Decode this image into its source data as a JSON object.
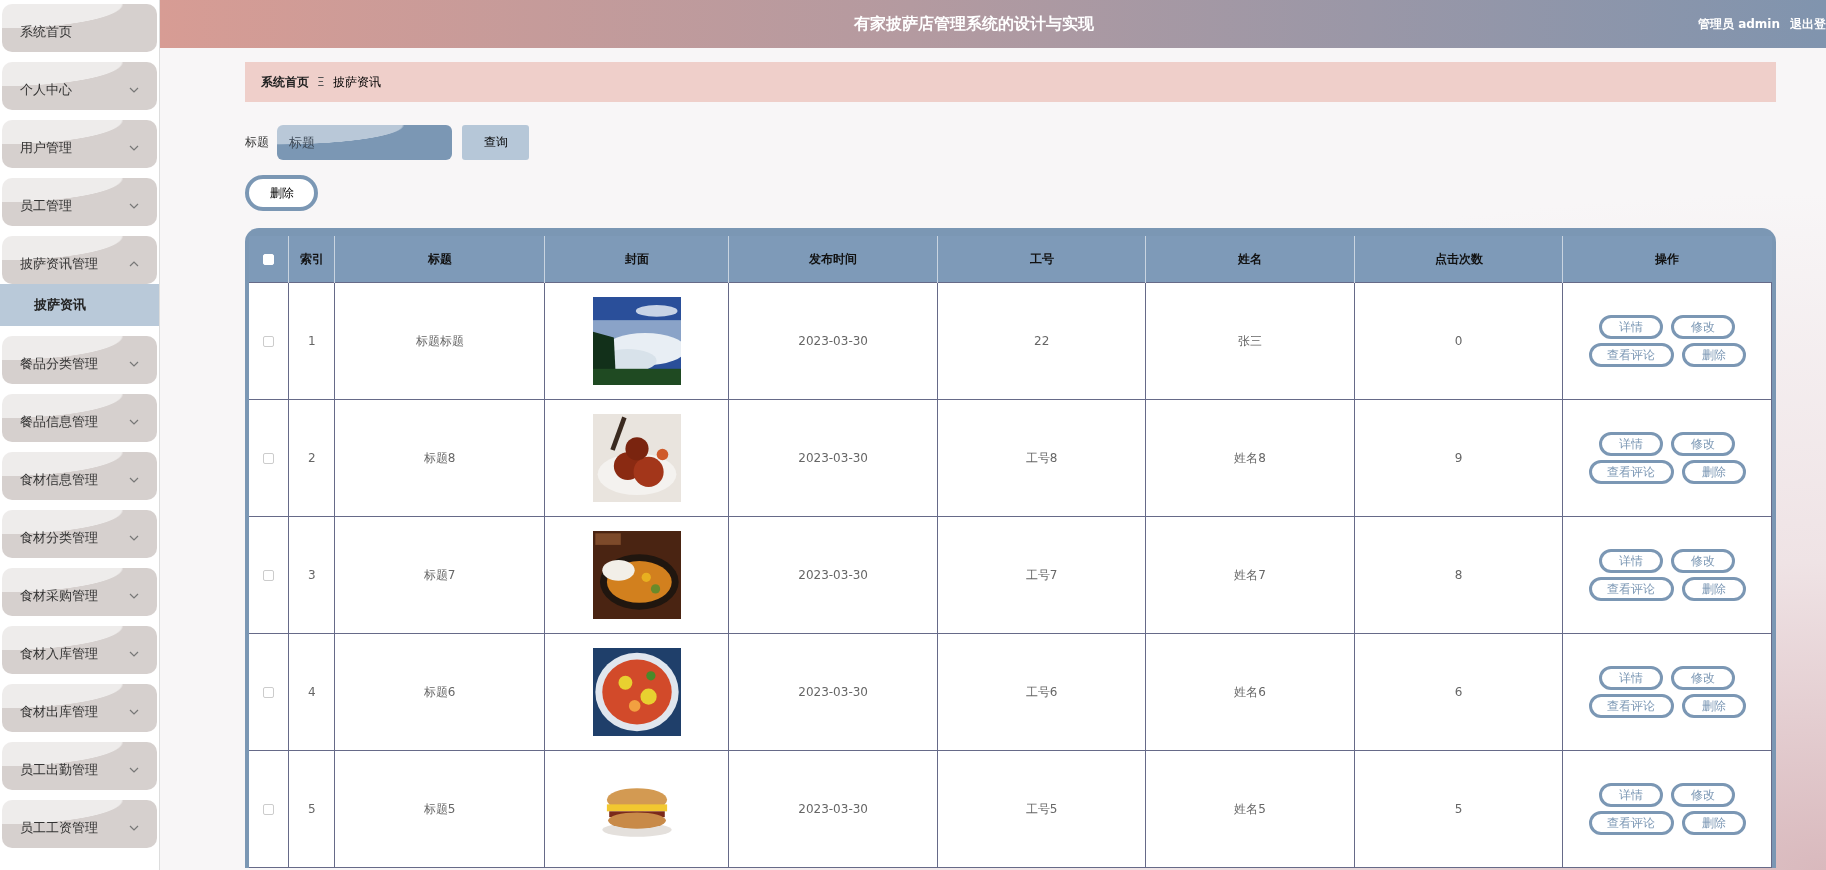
{
  "header": {
    "title": "有家披萨店管理系统的设计与实现",
    "user": "管理员 admin",
    "logout": "退出登"
  },
  "sidebar": {
    "items": [
      {
        "label": "系统首页",
        "kind": "link"
      },
      {
        "label": "个人中心",
        "kind": "menu",
        "expanded": false
      },
      {
        "label": "用户管理",
        "kind": "menu",
        "expanded": false
      },
      {
        "label": "员工管理",
        "kind": "menu",
        "expanded": false
      },
      {
        "label": "披萨资讯管理",
        "kind": "menu",
        "expanded": true,
        "children": [
          {
            "label": "披萨资讯",
            "selected": true
          }
        ]
      },
      {
        "label": "餐品分类管理",
        "kind": "menu",
        "expanded": false
      },
      {
        "label": "餐品信息管理",
        "kind": "menu",
        "expanded": false
      },
      {
        "label": "食材信息管理",
        "kind": "menu",
        "expanded": false
      },
      {
        "label": "食材分类管理",
        "kind": "menu",
        "expanded": false
      },
      {
        "label": "食材采购管理",
        "kind": "menu",
        "expanded": false
      },
      {
        "label": "食材入库管理",
        "kind": "menu",
        "expanded": false
      },
      {
        "label": "食材出库管理",
        "kind": "menu",
        "expanded": false
      },
      {
        "label": "员工出勤管理",
        "kind": "menu",
        "expanded": false
      },
      {
        "label": "员工工资管理",
        "kind": "menu",
        "expanded": false
      }
    ]
  },
  "breadcrumb": {
    "home": "系统首页",
    "separator": "Ξ",
    "current": "披萨资讯"
  },
  "search": {
    "label": "标题",
    "placeholder": "标题",
    "button": "查询"
  },
  "delete_button": "删除",
  "table": {
    "columns": [
      "索引",
      "标题",
      "封面",
      "发布时间",
      "工号",
      "姓名",
      "点击次数",
      "操作"
    ],
    "select_all_checked": false,
    "rows": [
      {
        "checked": false,
        "index": "1",
        "title": "标题标题",
        "cover": {
          "kind": "picture"
        },
        "date": "2023-03-30",
        "staff_no": "22",
        "name": "张三",
        "clicks": "0",
        "actions": [
          "详情",
          "修改",
          "查看评论",
          "删除"
        ]
      },
      {
        "checked": false,
        "index": "2",
        "title": "标题8",
        "cover": {
          "kind": "picture"
        },
        "date": "2023-03-30",
        "staff_no": "工号8",
        "name": "姓名8",
        "clicks": "9",
        "actions": [
          "详情",
          "修改",
          "查看评论",
          "删除"
        ]
      },
      {
        "checked": false,
        "index": "3",
        "title": "标题7",
        "cover": {
          "kind": "picture"
        },
        "date": "2023-03-30",
        "staff_no": "工号7",
        "name": "姓名7",
        "clicks": "8",
        "actions": [
          "详情",
          "修改",
          "查看评论",
          "删除"
        ]
      },
      {
        "checked": false,
        "index": "4",
        "title": "标题6",
        "cover": {
          "kind": "picture"
        },
        "date": "2023-03-30",
        "staff_no": "工号6",
        "name": "姓名6",
        "clicks": "6",
        "actions": [
          "详情",
          "修改",
          "查看评论",
          "删除"
        ]
      },
      {
        "checked": false,
        "index": "5",
        "title": "标题5",
        "cover": {
          "kind": "picture"
        },
        "date": "2023-03-30",
        "staff_no": "工号5",
        "name": "姓名5",
        "clicks": "5",
        "actions": [
          "详情",
          "修改",
          "查看评论",
          "删除"
        ]
      }
    ]
  }
}
